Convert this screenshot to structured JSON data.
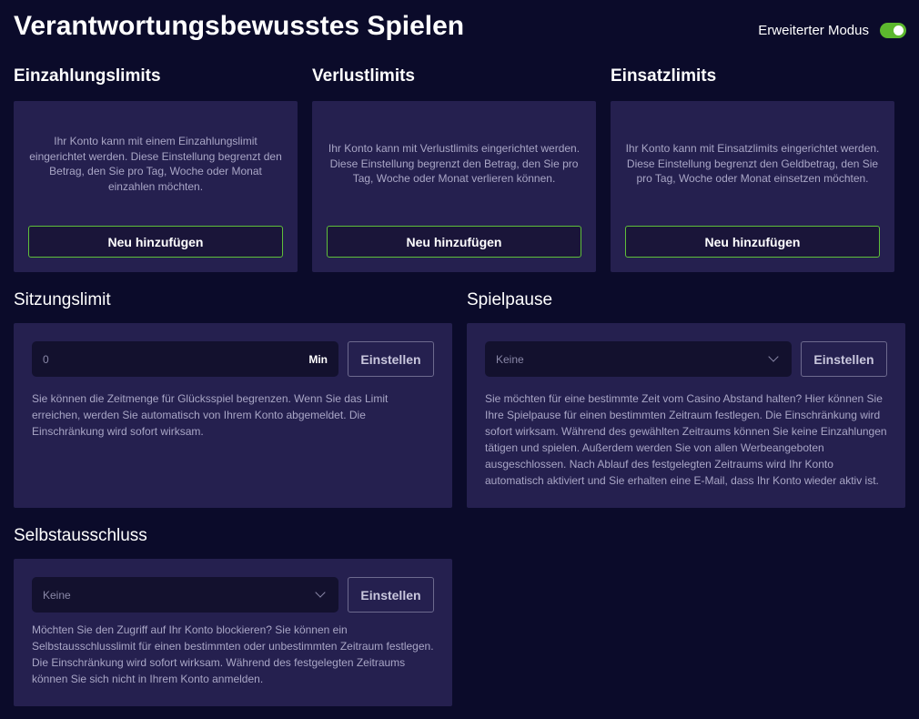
{
  "header": {
    "title": "Verantwortungsbewusstes Spielen",
    "mode_label": "Erweiterter Modus",
    "mode_enabled": true,
    "toggle_color": "#5cb82e"
  },
  "limits": [
    {
      "title": "Einzahlungslimits",
      "text": "Ihr Konto kann mit einem Einzahlungslimit eingerichtet werden. Diese Einstellung begrenzt den Betrag, den Sie pro Tag, Woche oder Monat einzahlen möchten.",
      "button": "Neu hinzufügen"
    },
    {
      "title": "Verlustlimits",
      "text": "Ihr Konto kann mit Verlustlimits eingerichtet werden. Diese Einstellung begrenzt den Betrag, den Sie pro Tag, Woche oder Monat verlieren können.",
      "button": "Neu hinzufügen"
    },
    {
      "title": "Einsatzlimits",
      "text": "Ihr Konto kann mit Einsatzlimits eingerichtet werden. Diese Einstellung begrenzt den Geldbetrag, den Sie pro Tag, Woche oder Monat einsetzen möchten.",
      "button": "Neu hinzufügen"
    }
  ],
  "session": {
    "title": "Sitzungslimit",
    "value": "0",
    "unit": "Min",
    "button": "Einstellen",
    "description": "Sie können die Zeitmenge für Glücksspiel begrenzen. Wenn Sie das Limit erreichen, werden Sie automatisch von Ihrem Konto abgemeldet. Die Einschränkung wird sofort wirksam."
  },
  "pause": {
    "title": "Spielpause",
    "selected": "Keine",
    "button": "Einstellen",
    "description": "Sie möchten für eine bestimmte Zeit vom Casino Abstand halten? Hier können Sie Ihre Spielpause für einen bestimmten Zeitraum festlegen. Die Einschränkung wird sofort wirksam. Während des gewählten Zeitraums können Sie keine Einzahlungen tätigen und spielen. Außerdem werden Sie von allen Werbeangeboten ausgeschlossen. Nach Ablauf des festgelegten Zeitraums wird Ihr Konto automatisch aktiviert und Sie erhalten eine E-Mail, dass Ihr Konto wieder aktiv ist."
  },
  "exclusion": {
    "title": "Selbstausschluss",
    "selected": "Keine",
    "button": "Einstellen",
    "description": "Möchten Sie den Zugriff auf Ihr Konto blockieren? Sie können ein Selbstausschlusslimit für einen bestimmten oder unbestimmten Zeitraum festlegen. Die Einschränkung wird sofort wirksam. Während des festgelegten Zeitraums können Sie sich nicht in Ihrem Konto anmelden."
  },
  "colors": {
    "background": "#0b0b2a",
    "card": "#25204f",
    "accent_border": "#5fbf3a"
  }
}
